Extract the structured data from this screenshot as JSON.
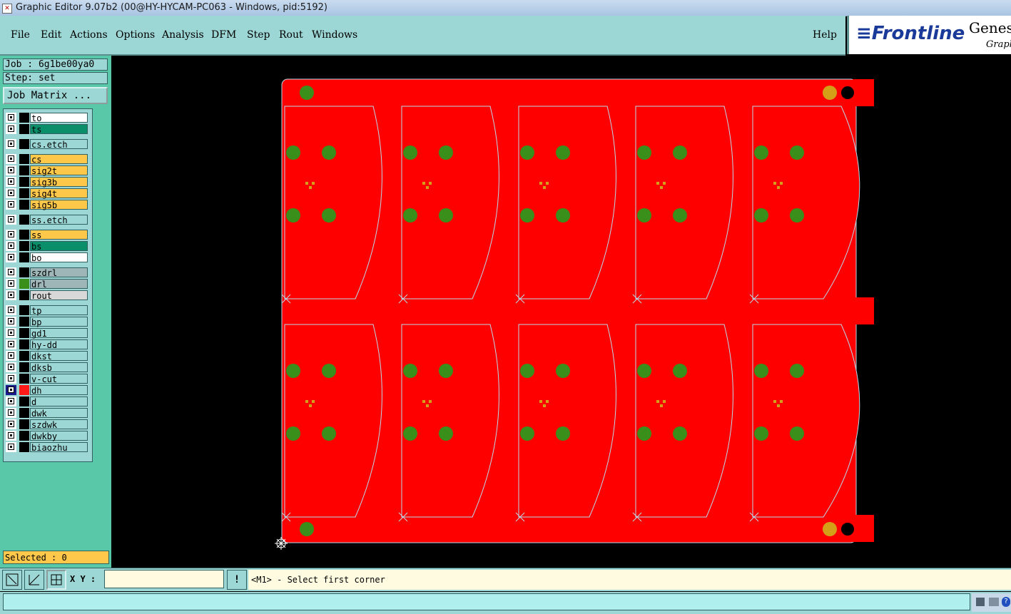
{
  "window": {
    "title": "Graphic Editor 9.07b2 (00@HY-HYCAM-PC063 - Windows, pid:5192)"
  },
  "menu": {
    "items": [
      "File",
      "Edit",
      "Actions",
      "Options",
      "Analysis",
      "DFM",
      "Step",
      "Rout",
      "Windows"
    ],
    "help": "Help"
  },
  "brand": {
    "logo": "Frontline",
    "product": "Genes",
    "subtitle": "Graph"
  },
  "job": {
    "job_label": "Job : 6g1be00ya0",
    "step_label": "Step: set",
    "matrix_button": "Job Matrix ..."
  },
  "layers": [
    {
      "name": "to",
      "color": "#ffffff",
      "gap_before": false
    },
    {
      "name": "ts",
      "color": "#0a8f6a",
      "gap_before": false
    },
    {
      "name": "cs.etch",
      "color": "#9dd7d5",
      "gap_before": true
    },
    {
      "name": "cs",
      "color": "#ffc84a",
      "gap_before": true
    },
    {
      "name": "sig2t",
      "color": "#ffc84a",
      "gap_before": false
    },
    {
      "name": "sig3b",
      "color": "#ffc84a",
      "gap_before": false
    },
    {
      "name": "sig4t",
      "color": "#ffc84a",
      "gap_before": false
    },
    {
      "name": "sig5b",
      "color": "#ffc84a",
      "gap_before": false
    },
    {
      "name": "ss.etch",
      "color": "#9dd7d5",
      "gap_before": true
    },
    {
      "name": "ss",
      "color": "#ffc84a",
      "gap_before": true
    },
    {
      "name": "bs",
      "color": "#0a8f6a",
      "gap_before": false
    },
    {
      "name": "bo",
      "color": "#ffffff",
      "gap_before": false
    },
    {
      "name": "szdrl",
      "color": "#9fb6b8",
      "gap_before": true
    },
    {
      "name": "drl",
      "color": "#9fb6b8",
      "gap_before": false,
      "swatch": "#3a8f1a"
    },
    {
      "name": "rout",
      "color": "#d8d8d8",
      "gap_before": false
    },
    {
      "name": "tp",
      "color": "#9dd7d5",
      "gap_before": true
    },
    {
      "name": "bp",
      "color": "#9dd7d5",
      "gap_before": false
    },
    {
      "name": "gd1",
      "color": "#9dd7d5",
      "gap_before": false
    },
    {
      "name": "hy-dd",
      "color": "#9dd7d5",
      "gap_before": false
    },
    {
      "name": "dkst",
      "color": "#9dd7d5",
      "gap_before": false
    },
    {
      "name": "dksb",
      "color": "#9dd7d5",
      "gap_before": false
    },
    {
      "name": "v-cut",
      "color": "#9dd7d5",
      "gap_before": false
    },
    {
      "name": "dh",
      "color": "#9dd7d5",
      "gap_before": false,
      "swatch": "#ff1a1a",
      "active": true
    },
    {
      "name": "d",
      "color": "#9dd7d5",
      "gap_before": false
    },
    {
      "name": "dwk",
      "color": "#9dd7d5",
      "gap_before": false
    },
    {
      "name": "szdwk",
      "color": "#9dd7d5",
      "gap_before": false
    },
    {
      "name": "dwkby",
      "color": "#9dd7d5",
      "gap_before": false
    },
    {
      "name": "biaozhu",
      "color": "#9dd7d5",
      "gap_before": false
    }
  ],
  "selection": {
    "label": "Selected : 0"
  },
  "coords": {
    "label": "X Y :",
    "value": ""
  },
  "prompt": {
    "text": "<M1> - Select first corner"
  },
  "colors": {
    "board": "#ff0000",
    "pad": "#3a8f1a",
    "fiducial": "#d4a017",
    "outline": "#b8d8e8"
  }
}
